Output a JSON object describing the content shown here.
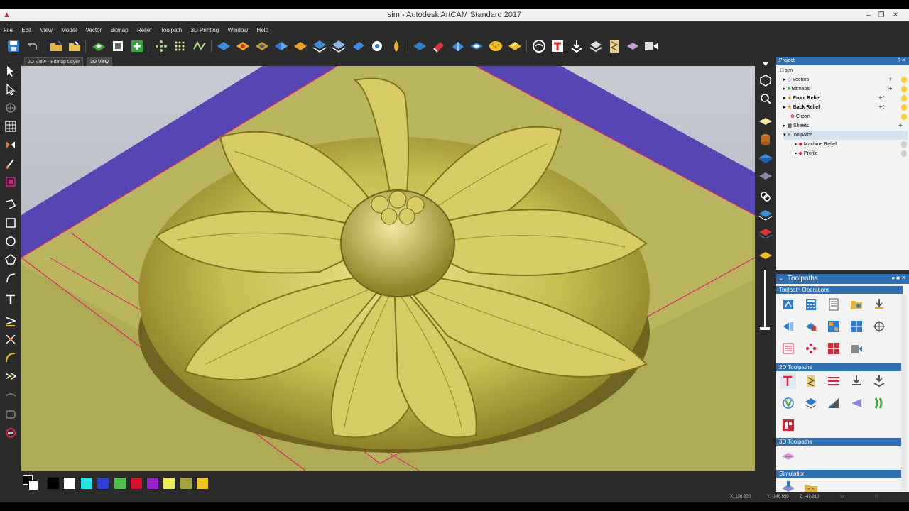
{
  "window": {
    "title": "sim - Autodesk ArtCAM Standard 2017",
    "minimize": "–",
    "restore": "❐",
    "close": "✕"
  },
  "menu": [
    "File",
    "Edit",
    "View",
    "Model",
    "Vector",
    "Bitmap",
    "Relief",
    "Toolpath",
    "3D Printing",
    "Window",
    "Help"
  ],
  "view_tabs": {
    "tab_2d": "2D View - Bitmap Layer",
    "tab_3d": "3D View"
  },
  "project": {
    "header": "Project",
    "header_controls": "? ✕",
    "root": "sim",
    "items": [
      {
        "label": "Vectors",
        "bold": false
      },
      {
        "label": "Bitmaps",
        "bold": false
      },
      {
        "label": "Front Relief",
        "bold": true
      },
      {
        "label": "Back Relief",
        "bold": true
      },
      {
        "label": "Clipart",
        "bold": false
      },
      {
        "label": "Sheets",
        "bold": false
      },
      {
        "label": "Toolpaths",
        "bold": false
      }
    ],
    "toolpath_children": [
      "Machine Relief",
      "Profile"
    ]
  },
  "toolpaths_panel": {
    "title": "Toolpaths",
    "sections": {
      "operations": "Toolpath Operations",
      "two_d": "2D Toolpaths",
      "three_d": "3D Toolpaths",
      "simulation": "Simulation"
    }
  },
  "palette": {
    "colors": [
      "#000000",
      "#ffffff",
      "#22e6e6",
      "#2f3fd6",
      "#4cc24c",
      "#d2122a",
      "#9a22c9",
      "#ecec58",
      "#a7a23a",
      "#f2c41a"
    ]
  },
  "status": {
    "x": "X: 136.500",
    "y": "Y: -146.550",
    "z": "Z: -49.910",
    "w": "W:",
    "h": "H:"
  },
  "colors": {
    "accent": "#2d6fb3",
    "relief": "#c9c055",
    "material_top": "#a7a23a",
    "side": "#5a4fb0",
    "outline": "#e0246a"
  }
}
